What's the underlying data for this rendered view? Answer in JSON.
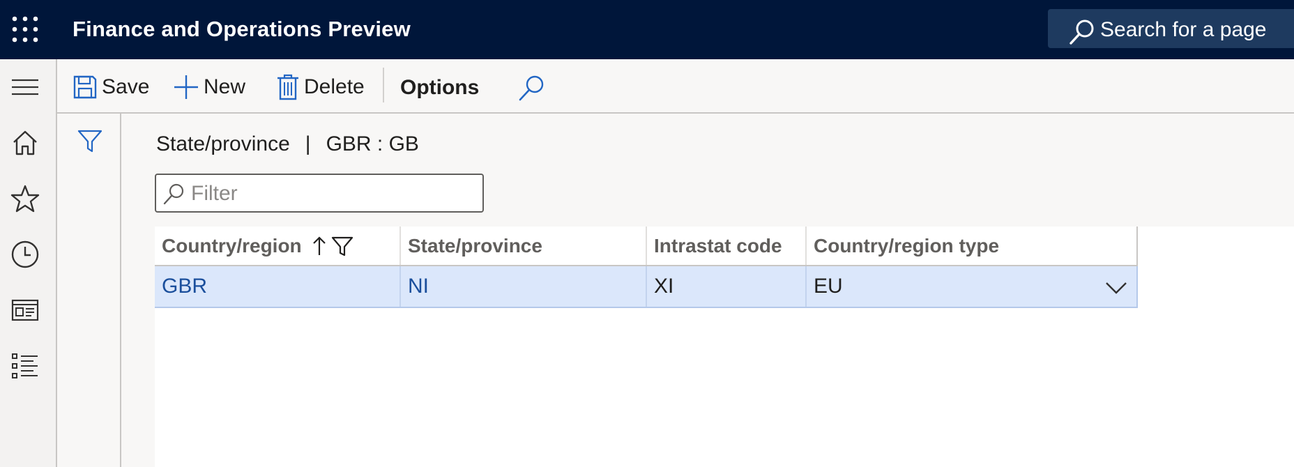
{
  "app": {
    "title": "Finance and Operations Preview"
  },
  "search": {
    "label": "Search for a page"
  },
  "actions": {
    "save": "Save",
    "new": "New",
    "delete": "Delete",
    "options": "Options"
  },
  "breadcrumb": {
    "page": "State/province",
    "separator": "|",
    "record": "GBR : GB"
  },
  "filter": {
    "placeholder": "Filter",
    "value": ""
  },
  "grid": {
    "columns": [
      "Country/region",
      "State/province",
      "Intrastat code",
      "Country/region type"
    ],
    "rows": [
      {
        "country_region": "GBR",
        "state_province": "NI",
        "intrastat_code": "XI",
        "country_region_type": "EU"
      }
    ]
  },
  "colors": {
    "topbar": "#00163a",
    "selected_row": "#dbe7fb",
    "link": "#1b4f9c",
    "accent": "#2266c4"
  }
}
